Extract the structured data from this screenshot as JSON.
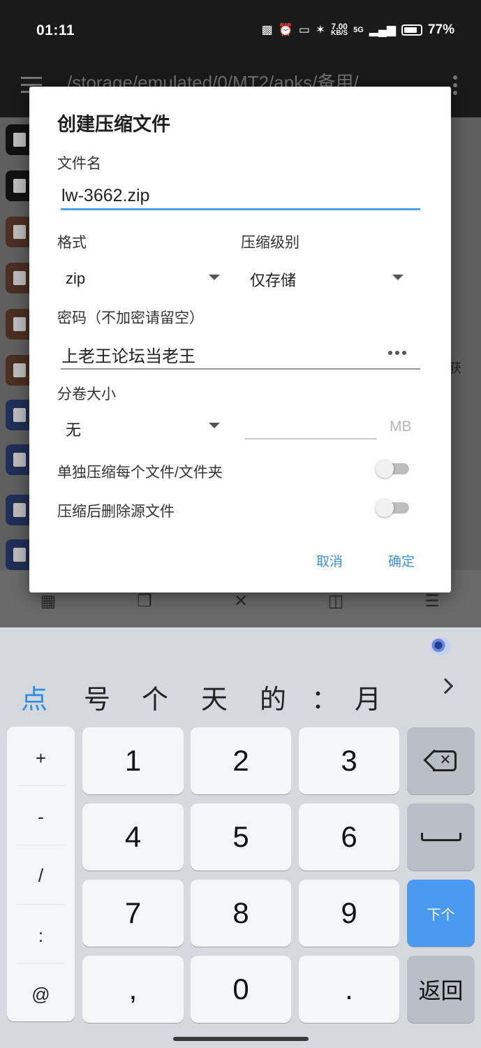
{
  "status_bar": {
    "time": "01:11",
    "net_speed_value": "7.00",
    "net_speed_unit": "KB/S",
    "network": "5G",
    "battery": "77%"
  },
  "app_bar": {
    "path": "/storage/emulated/0/MT2/apks/备用/"
  },
  "background": {
    "partial_text": "获",
    "file_icons": [
      "folder",
      "folder",
      "archive",
      "archive",
      "archive",
      "archive",
      "document",
      "document",
      "document",
      "document"
    ]
  },
  "dialog": {
    "title": "创建压缩文件",
    "filename_label": "文件名",
    "filename_value": "lw-3662.zip",
    "format_label": "格式",
    "format_value": "zip",
    "level_label": "压缩级别",
    "level_value": "仅存储",
    "password_label": "密码（不加密请留空）",
    "password_value": "上老王论坛当老王",
    "split_label": "分卷大小",
    "split_value": "无",
    "split_unit": "MB",
    "toggle_each_label": "单独压缩每个文件/文件夹",
    "toggle_each_on": false,
    "toggle_delete_label": "压缩后删除源文件",
    "toggle_delete_on": false,
    "cancel_label": "取消",
    "ok_label": "确定"
  },
  "colors": {
    "accent": "#3d8fd6",
    "enter_key": "#4a9af2"
  },
  "keyboard": {
    "candidates": [
      "点",
      "号",
      "个",
      "天",
      "的",
      "：",
      "月"
    ],
    "symbols": [
      "+",
      "-",
      "/",
      ":",
      "@"
    ],
    "digits": [
      "1",
      "2",
      "3",
      "4",
      "5",
      "6",
      "7",
      "8",
      "9",
      ",",
      "0",
      "."
    ],
    "enter_label": "下个",
    "return_label": "返回"
  }
}
